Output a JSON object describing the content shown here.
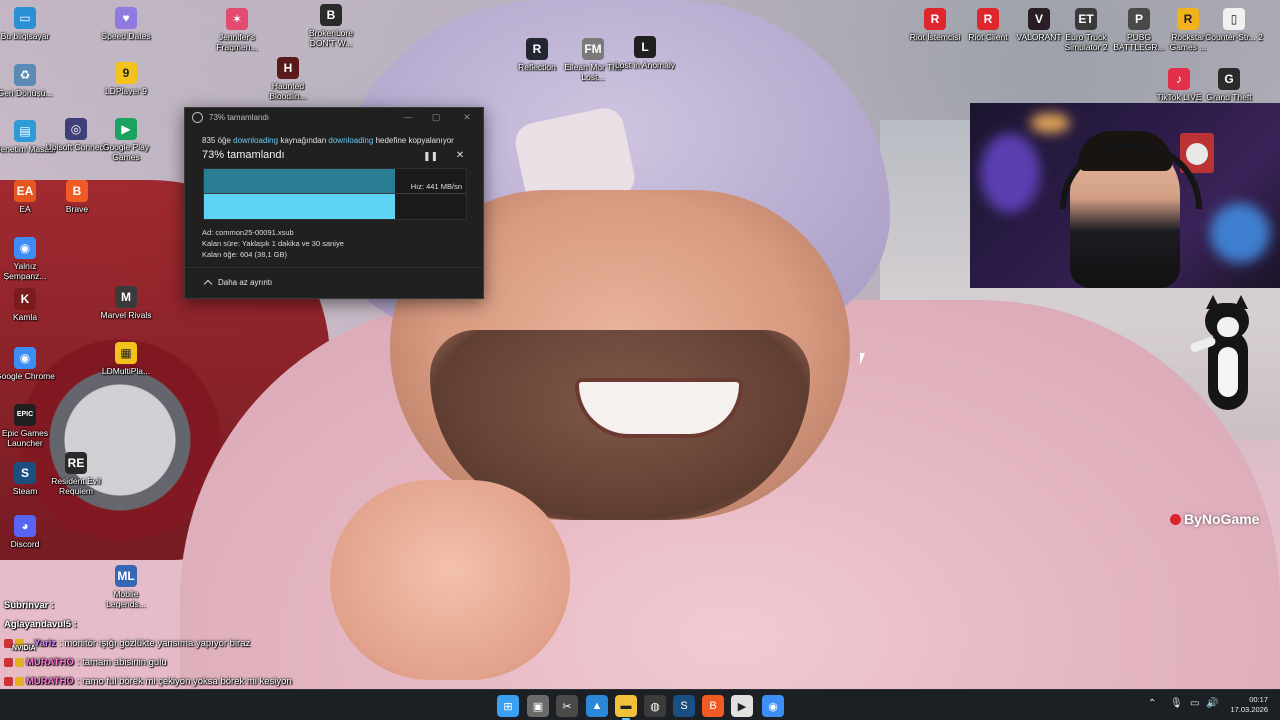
{
  "desktop_icons_left": [
    {
      "label": "Bu bilgisayar",
      "icon": "computer-icon",
      "color": "#2b8fd6",
      "glyph": "▭"
    },
    {
      "label": "Geri Dönüşü...",
      "icon": "recycle-bin-icon",
      "color": "#5b8bb5",
      "glyph": "♻"
    },
    {
      "label": "Denetim Masası",
      "icon": "control-panel-icon",
      "color": "#2c9bd6",
      "glyph": "▤"
    },
    {
      "label": "EA",
      "icon": "ea-icon",
      "color": "#e5571f",
      "glyph": "EA"
    },
    {
      "label": "Yalnız Şempanz...",
      "icon": "chrome-icon",
      "color": "#3d8df5",
      "glyph": "◉"
    },
    {
      "label": "Kamla",
      "icon": "kamla-icon",
      "color": "#7a1c1c",
      "glyph": "K"
    },
    {
      "label": "Google Chrome",
      "icon": "chrome-icon",
      "color": "#3d8df5",
      "glyph": "◉"
    },
    {
      "label": "Epic Games Launcher",
      "icon": "epic-games-icon",
      "color": "#202020",
      "glyph": "EPIC"
    },
    {
      "label": "Steam",
      "icon": "steam-icon",
      "color": "#1b4f82",
      "glyph": "S"
    },
    {
      "label": "Discord",
      "icon": "discord-icon",
      "color": "#5865f2",
      "glyph": "◕"
    }
  ],
  "desktop_icons_col2": [
    {
      "label": "Speed Dates",
      "icon": "speed-dates-icon",
      "color": "#8f7ae0",
      "glyph": "♥"
    },
    {
      "label": "LDPlayer 9",
      "icon": "ldplayer-icon",
      "color": "#f3c21c",
      "glyph": "9"
    },
    {
      "label": "Ubisoft Connect",
      "icon": "ubisoft-icon",
      "color": "#3f3f7a",
      "glyph": "◎"
    },
    {
      "label": "Google Play Games",
      "icon": "google-play-games-icon",
      "color": "#1aa260",
      "glyph": "▶"
    },
    {
      "label": "Brave",
      "icon": "brave-icon",
      "color": "#f05a23",
      "glyph": "B"
    },
    {
      "label": "Marvel Rivals",
      "icon": "marvel-rivals-icon",
      "color": "#3a3a3a",
      "glyph": "M"
    },
    {
      "label": "LDMultiPla...",
      "icon": "ldmultiplayer-icon",
      "color": "#f3c21c",
      "glyph": "▦"
    },
    {
      "label": "Resident Evil Requiem",
      "icon": "resident-evil-icon",
      "color": "#2a2a2a",
      "glyph": "RE"
    },
    {
      "label": "Mobile Legends...",
      "icon": "mobile-legends-icon",
      "color": "#3567b5",
      "glyph": "ML"
    }
  ],
  "desktop_icons_top": [
    {
      "label": "Jennifer's Fragmen...",
      "icon": "jennifer-icon",
      "color": "#e34a6f",
      "glyph": "✶"
    },
    {
      "label": "Haunted Bloodlin...",
      "icon": "haunted-icon",
      "color": "#5a1a1a",
      "glyph": "H"
    },
    {
      "label": "BrokenLore DON'T W...",
      "icon": "brokenlore-icon",
      "color": "#2a2a2a",
      "glyph": "B"
    },
    {
      "label": "Reflection",
      "icon": "reflection-icon",
      "color": "#222833",
      "glyph": "R"
    },
    {
      "label": "Ellean Mor The Lost...",
      "icon": "ellean-icon",
      "color": "#7a7a7a",
      "glyph": "FM"
    },
    {
      "label": "Lost in Anomaly",
      "icon": "lost-anomaly-icon",
      "color": "#1f1f1f",
      "glyph": "L"
    }
  ],
  "desktop_icons_right": [
    {
      "label": "Riot İstemcisi",
      "icon": "riot-icon",
      "color": "#e0262d",
      "glyph": "R"
    },
    {
      "label": "Riot Client",
      "icon": "riot-icon",
      "color": "#e0262d",
      "glyph": "R"
    },
    {
      "label": "VALORANT",
      "icon": "valorant-icon",
      "color": "#2a1d25",
      "glyph": "V"
    },
    {
      "label": "Euro Truck Simulator 2",
      "icon": "euro-truck-icon",
      "color": "#3a3a3a",
      "glyph": "ET"
    },
    {
      "label": "PUBG BATTLEGR...",
      "icon": "pubg-icon",
      "color": "#4a4a4a",
      "glyph": "P"
    },
    {
      "label": "Rockstar Games ...",
      "icon": "rockstar-icon",
      "color": "#f2b21b",
      "glyph": "R"
    },
    {
      "label": "Counter-Str... 2",
      "icon": "file-icon",
      "color": "#f1f1f1",
      "glyph": "▯"
    },
    {
      "label": "TikTok LIVE",
      "icon": "tiktok-icon",
      "color": "#e2304b",
      "glyph": "♪"
    },
    {
      "label": "Grand Theft",
      "icon": "gta-icon",
      "color": "#2b2b2b",
      "glyph": "G"
    }
  ],
  "copy_dialog": {
    "title": "73% tamamlandı",
    "desc_count": "835 öğe",
    "desc_source": "downloading",
    "desc_mid": "kaynağından",
    "desc_dest": "downloading",
    "desc_end": "hedefine kopyalanıyor",
    "percent_text": "73% tamamlandı",
    "progress_fraction": 0.73,
    "speed": "Hız: 441 MB/sn",
    "name_line": "Ad:  common25-00091.xsub",
    "time_line": "Kalan süre:  Yaklaşık 1 dakika ve 30 saniye",
    "items_line": "Kalan öğe:  604 (38,1 GB)",
    "less_details": "Daha az ayrıntı",
    "accent_color": "#5fd3f3"
  },
  "watermark": "ByNoGame",
  "chat": [
    {
      "user": "Subrinvar :",
      "msg": "",
      "color": "#ffffff"
    },
    {
      "user": "Aglayandavul5 :",
      "msg": "",
      "color": "#ffffff"
    },
    {
      "user": "...Yariz",
      "msg": ": monitör ışığı gözlükte yansıma yapıyor biraz",
      "color": "#d58cff"
    },
    {
      "user": "MURATHO",
      "msg": ": tamam abisinin gulu",
      "color": "#ff7bd8"
    },
    {
      "user": "MURATHO",
      "msg": ": ramo ful börek mi çekiyon yoksa börek mi kesiyon",
      "color": "#ff7bd8"
    }
  ],
  "chat_extra": "NVIDIA",
  "taskbar": {
    "apps": [
      {
        "name": "start-button",
        "color": "#3aa0f2",
        "glyph": "⊞"
      },
      {
        "name": "task-view-button",
        "color": "#6b6b6b",
        "glyph": "▣"
      },
      {
        "name": "snipping-tool-app",
        "color": "#4a4a4a",
        "glyph": "✂"
      },
      {
        "name": "photos-app",
        "color": "#2b88d8",
        "glyph": "▲"
      },
      {
        "name": "file-explorer-app",
        "color": "#f2c13a",
        "glyph": "▬"
      },
      {
        "name": "obs-app",
        "color": "#3b3b3b",
        "glyph": "◍"
      },
      {
        "name": "steam-app",
        "color": "#1b4f82",
        "glyph": "S"
      },
      {
        "name": "brave-app",
        "color": "#f05a23",
        "glyph": "B"
      },
      {
        "name": "media-app",
        "color": "#e0e0e0",
        "glyph": "▶"
      },
      {
        "name": "chrome-app",
        "color": "#3d8df5",
        "glyph": "◉"
      }
    ],
    "time": "00:17",
    "date": "17.03.2026"
  }
}
